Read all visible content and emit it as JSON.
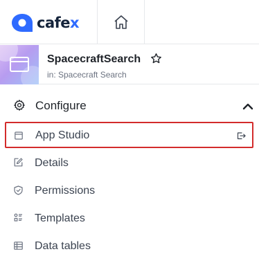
{
  "brand": {
    "logo_text_main": "cafe",
    "logo_text_accent": "x",
    "accent_color": "#2f6bff"
  },
  "topbar": {
    "home_icon": "home-icon"
  },
  "app": {
    "title": "SpacecraftSearch",
    "subtitle": "in: Spacecraft Search",
    "favorite_icon": "star-icon"
  },
  "section": {
    "label": "Configure",
    "icon": "gear-icon",
    "toggle_icon": "chevron-up-icon"
  },
  "nav": {
    "items": [
      {
        "label": "App Studio",
        "icon": "window-icon",
        "selected": true,
        "trailing_icon": "open-external-icon"
      },
      {
        "label": "Details",
        "icon": "edit-document-icon"
      },
      {
        "label": "Permissions",
        "icon": "shield-icon"
      },
      {
        "label": "Templates",
        "icon": "templates-icon"
      },
      {
        "label": "Data tables",
        "icon": "table-icon"
      }
    ]
  },
  "colors": {
    "highlight_border": "#d32b2b"
  }
}
